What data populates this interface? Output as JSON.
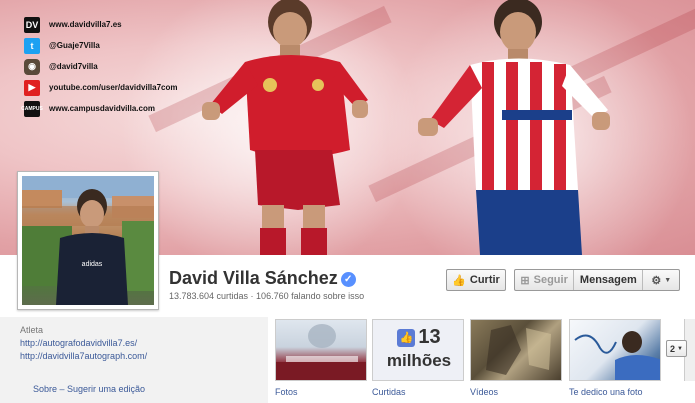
{
  "cover": {
    "social_links": [
      {
        "icon": "site-logo-icon",
        "text": "www.davidvilla7.es"
      },
      {
        "icon": "twitter-icon",
        "text": "@Guaje7Villa"
      },
      {
        "icon": "instagram-icon",
        "text": "@david7villa"
      },
      {
        "icon": "youtube-icon",
        "text": "youtube.com/user/davidvilla7com"
      },
      {
        "icon": "campus-logo-icon",
        "text": "www.campusdavidvilla.com"
      }
    ]
  },
  "profile": {
    "name": "David Villa Sánchez",
    "verified": true,
    "stats": "13.783.604 curtidas · 106.760 falando sobre isso"
  },
  "actions": {
    "like_label": "Curtir",
    "follow_label": "Seguir",
    "message_label": "Mensagem",
    "settings_icon": "gear-icon"
  },
  "about": {
    "category": "Atleta",
    "links": [
      "http://autografodavidvilla7.es/",
      "http://davidvilla7autograph.com/"
    ],
    "footer": "Sobre – Sugerir uma edição"
  },
  "apps": [
    {
      "label": "Fotos"
    },
    {
      "label": "Curtidas",
      "count": "13",
      "unit": "milhões"
    },
    {
      "label": "Vídeos"
    },
    {
      "label": "Te dedico una foto"
    }
  ],
  "more_apps": {
    "label": "2"
  },
  "colors": {
    "link": "#3b5998",
    "verified": "#5890ff"
  }
}
